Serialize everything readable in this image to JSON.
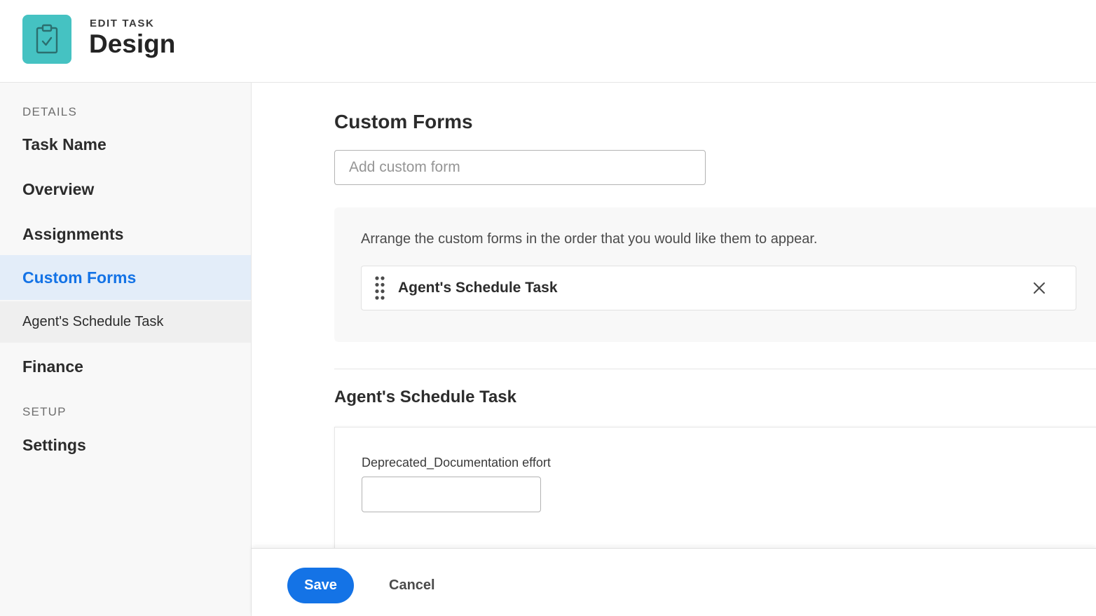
{
  "header": {
    "kicker": "EDIT TASK",
    "title": "Design",
    "icon": "clipboard-check-icon",
    "icon_bg": "#45c2c2"
  },
  "sidebar": {
    "details_label": "DETAILS",
    "items": [
      {
        "label": "Task Name"
      },
      {
        "label": "Overview"
      },
      {
        "label": "Assignments"
      },
      {
        "label": "Custom Forms",
        "active": true
      },
      {
        "label": "Agent's Schedule Task",
        "sub": true
      },
      {
        "label": "Finance"
      }
    ],
    "setup_label": "SETUP",
    "setup_items": [
      {
        "label": "Settings"
      }
    ]
  },
  "main": {
    "section_title": "Custom Forms",
    "add_form_placeholder": "Add custom form",
    "order_hint": "Arrange the custom forms in the order that you would like them to appear.",
    "forms": [
      {
        "label": "Agent's Schedule Task"
      }
    ],
    "form_section_title": "Agent's Schedule Task",
    "fields": [
      {
        "label": "Deprecated_Documentation effort",
        "value": ""
      }
    ]
  },
  "footer": {
    "save_label": "Save",
    "cancel_label": "Cancel"
  },
  "colors": {
    "accent": "#1473e6",
    "active_bg": "#e3edf9"
  }
}
